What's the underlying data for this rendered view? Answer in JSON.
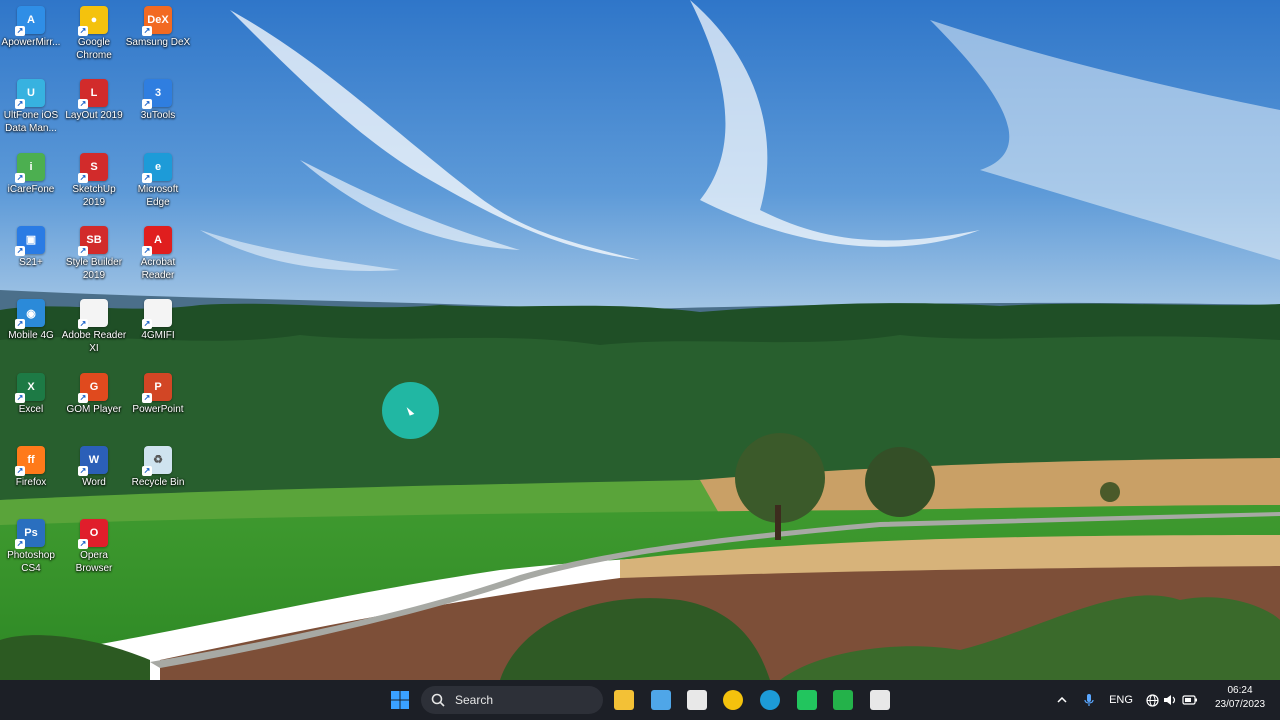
{
  "desktop": {
    "icons": [
      {
        "label": "ApowerMirr...",
        "icon": "apowermirror-icon",
        "color": "#2f8ee6",
        "glyph": "A"
      },
      {
        "label": "Google Chrome",
        "icon": "chrome-icon",
        "color": "#f4c20d",
        "glyph": "●"
      },
      {
        "label": "Samsung DeX",
        "icon": "samsung-dex-icon",
        "color": "#f26a22",
        "glyph": "DeX"
      },
      {
        "label": "UltFone iOS Data Man...",
        "icon": "ultfone-icon",
        "color": "#37b2e0",
        "glyph": "U"
      },
      {
        "label": "LayOut 2019",
        "icon": "layout-icon",
        "color": "#d22b2b",
        "glyph": "L"
      },
      {
        "label": "3uTools",
        "icon": "3utools-icon",
        "color": "#2f7ee0",
        "glyph": "3"
      },
      {
        "label": "iCareFone",
        "icon": "icarefone-icon",
        "color": "#4caf50",
        "glyph": "i"
      },
      {
        "label": "SketchUp 2019",
        "icon": "sketchup-icon",
        "color": "#d22b2b",
        "glyph": "S"
      },
      {
        "label": "Microsoft Edge",
        "icon": "edge-icon",
        "color": "#1d9bd8",
        "glyph": "e"
      },
      {
        "label": "S21+",
        "icon": "s21-icon",
        "color": "#2a7be4",
        "glyph": "▣"
      },
      {
        "label": "Style Builder 2019",
        "icon": "style-builder-icon",
        "color": "#d22b2b",
        "glyph": "SB"
      },
      {
        "label": "Acrobat Reader",
        "icon": "acrobat-icon",
        "color": "#e01e1e",
        "glyph": "A"
      },
      {
        "label": "Mobile 4G",
        "icon": "mobile-4g-icon",
        "color": "#2b8ad9",
        "glyph": "◉"
      },
      {
        "label": "Adobe Reader XI",
        "icon": "file-icon",
        "color": "#f4f4f4",
        "glyph": ""
      },
      {
        "label": "4GMIFI",
        "icon": "file-icon",
        "color": "#f4f4f4",
        "glyph": ""
      },
      {
        "label": "Excel",
        "icon": "excel-icon",
        "color": "#1d7a45",
        "glyph": "X"
      },
      {
        "label": "GOM Player",
        "icon": "gom-player-icon",
        "color": "#e04a1e",
        "glyph": "G"
      },
      {
        "label": "PowerPoint",
        "icon": "powerpoint-icon",
        "color": "#d24625",
        "glyph": "P"
      },
      {
        "label": "Firefox",
        "icon": "firefox-icon",
        "color": "#ff7a1a",
        "glyph": "ff"
      },
      {
        "label": "Word",
        "icon": "word-icon",
        "color": "#2b5fb8",
        "glyph": "W"
      },
      {
        "label": "Recycle Bin",
        "icon": "recycle-bin-icon",
        "color": "#cfe3ef",
        "glyph": "♻"
      },
      {
        "label": "Photoshop CS4",
        "icon": "photoshop-icon",
        "color": "#2a6fbf",
        "glyph": "Ps"
      },
      {
        "label": "Opera Browser",
        "icon": "opera-icon",
        "color": "#e01e2b",
        "glyph": "O"
      }
    ]
  },
  "taskbar": {
    "search_label": "Search",
    "apps": [
      {
        "icon": "start-icon",
        "color": "#3aa0ff"
      },
      {
        "icon": "file-explorer-icon",
        "color": "#f3c136"
      },
      {
        "icon": "notepad-icon",
        "color": "#4fa6e8"
      },
      {
        "icon": "microsoft-store-icon",
        "color": "#e8e8e8"
      },
      {
        "icon": "chrome-icon",
        "color": "#f4c20d"
      },
      {
        "icon": "edge-icon",
        "color": "#1d9bd8"
      },
      {
        "icon": "shield-app-icon",
        "color": "#22c55e"
      },
      {
        "icon": "camtasia-icon",
        "color": "#24b24a"
      },
      {
        "icon": "camtasia-recorder-icon",
        "color": "#e8e8e8"
      }
    ],
    "tray": {
      "language": "ENG",
      "time": "06:24",
      "date": "23/07/2023"
    }
  }
}
